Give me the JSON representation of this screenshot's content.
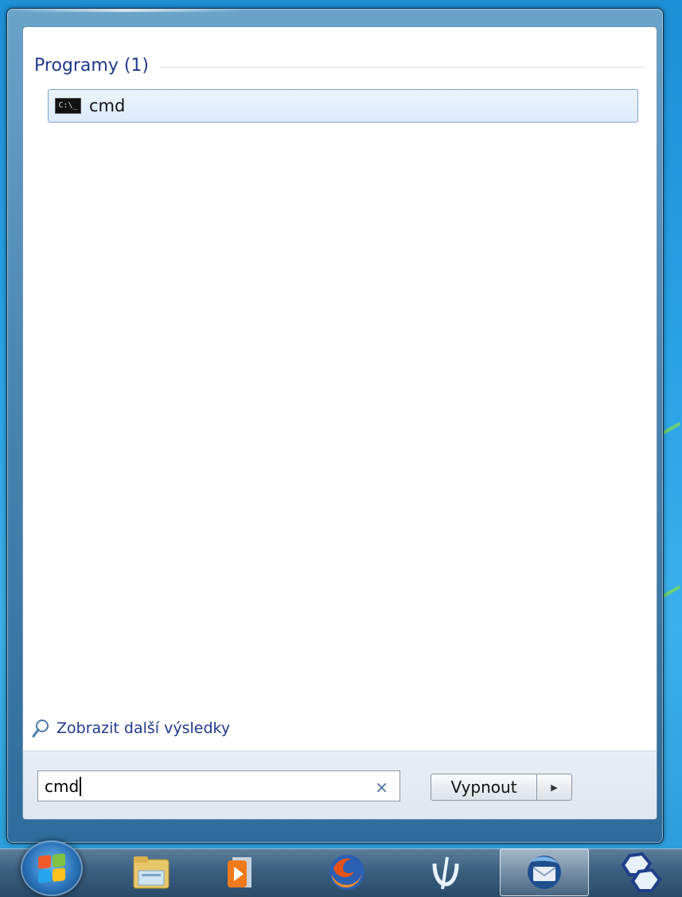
{
  "start_menu": {
    "section_title": "Programy (1)",
    "result_label": "cmd",
    "result_icon": "command-prompt-icon",
    "more_results_label": "Zobrazit další výsledky",
    "search_value": "cmd",
    "clear_symbol": "×",
    "shutdown_label": "Vypnout"
  },
  "taskbar": {
    "icons": [
      "start-orb-icon",
      "file-explorer-icon",
      "media-player-icon",
      "firefox-icon",
      "pen-app-icon",
      "thunderbird-icon",
      "network-app-icon"
    ]
  },
  "colors": {
    "link_blue": "#1e3a8c",
    "taskbar": "#3b5f7f"
  }
}
